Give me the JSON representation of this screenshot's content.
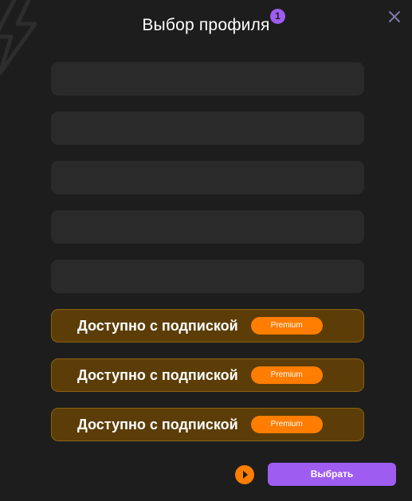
{
  "dialog": {
    "title": "Выбор профиля",
    "badge_count": "1",
    "close_icon": "close-icon"
  },
  "colors": {
    "background": "#1d1d1d",
    "empty_slot": "#2a2a2a",
    "locked_slot": "#5c3d07",
    "locked_border": "#8a6112",
    "accent_purple": "#9e5cf0",
    "accent_orange": "#ff7d00"
  },
  "slots": {
    "empty_count": 5,
    "locked": [
      {
        "label": "Доступно с подпиской",
        "badge": "Premium"
      },
      {
        "label": "Доступно с подпиской",
        "badge": "Premium"
      },
      {
        "label": "Доступно с подпиской",
        "badge": "Premium"
      }
    ]
  },
  "footer": {
    "play_icon": "play-icon",
    "select_label": "Выбрать"
  }
}
